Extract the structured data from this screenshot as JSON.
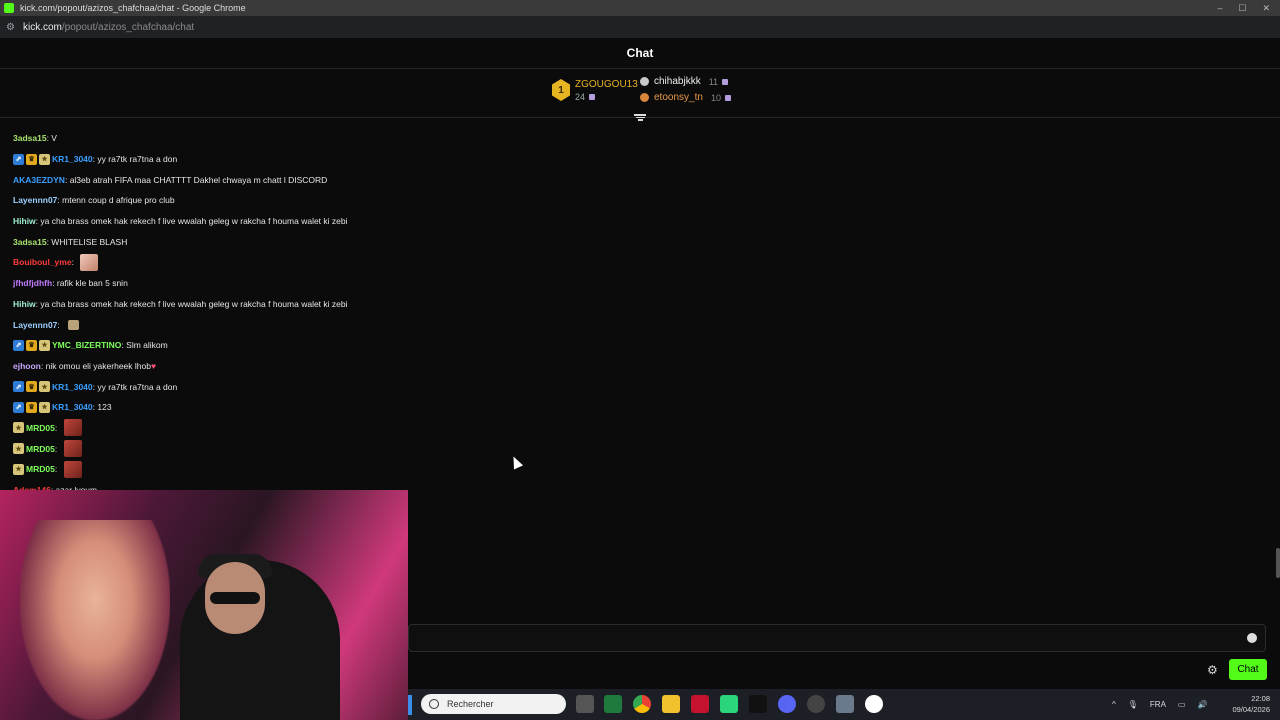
{
  "browser": {
    "window_title": "kick.com/popout/azizos_chafchaa/chat - Google Chrome",
    "url_host": "kick.com",
    "url_path": "/popout/azizos_chafchaa/chat"
  },
  "chat": {
    "title": "Chat",
    "leaderboard": {
      "first": {
        "rank": "1",
        "name": "ZGOUGOU13",
        "count": "24"
      },
      "second": {
        "name": "chihabjkkk",
        "count": "11"
      },
      "third": {
        "name": "etoonsy_tn",
        "count": "10"
      }
    },
    "messages": [
      {
        "user": "3adsa15",
        "color": "#a8e36b",
        "badges": [],
        "text": "V"
      },
      {
        "user": "KR1_3040",
        "color": "#3aa0ff",
        "badges": [
          "blue",
          "gold",
          "sub"
        ],
        "text": "yy ra7tk ra7tna a don"
      },
      {
        "user": "AKA3EZDYN",
        "color": "#3aa0ff",
        "badges": [],
        "text": "al3eb atrah FIFA maa CHATTTT Dakhel chwaya m chatt l DISCORD"
      },
      {
        "user": "Layennn07",
        "color": "#9ed0ff",
        "badges": [],
        "text": "mtenn coup d afrique pro club"
      },
      {
        "user": "Hihiw",
        "color": "#9ff0d0",
        "badges": [],
        "text": "ya cha brass omek hak rekech f live wwalah geleg w rakcha f houma walet ki zebi"
      },
      {
        "user": "3adsa15",
        "color": "#a8e36b",
        "badges": [],
        "text": "WHITELISE BLASH"
      },
      {
        "user": "Bouiboul_yme",
        "color": "#ff3b3b",
        "badges": [],
        "text": "",
        "emote": "face"
      },
      {
        "user": "jfhdfjdhfh",
        "color": "#c07bff",
        "badges": [],
        "text": "rafik kle ban 5 snin"
      },
      {
        "user": "Hihiw",
        "color": "#9ff0d0",
        "badges": [],
        "text": "ya cha brass omek hak rekech f live wwalah geleg w rakcha f houma walet ki zebi"
      },
      {
        "user": "Layennn07",
        "color": "#9ed0ff",
        "badges": [],
        "text": "",
        "emote": "small"
      },
      {
        "user": "YMC_BIZERTINO",
        "color": "#7dff5a",
        "badges": [
          "blue",
          "gold",
          "sub"
        ],
        "text": "Slm alikom"
      },
      {
        "user": "ejhoon",
        "color": "#c8a8ff",
        "badges": [],
        "text": "nik omou eli yakerheek lhob",
        "heart": "♥"
      },
      {
        "user": "KR1_3040",
        "color": "#3aa0ff",
        "badges": [
          "blue",
          "gold",
          "sub"
        ],
        "text": "yy ra7tk ra7tna a don"
      },
      {
        "user": "KR1_3040",
        "color": "#3aa0ff",
        "badges": [
          "blue",
          "gold",
          "sub"
        ],
        "text": "123"
      },
      {
        "user": "MRD05",
        "color": "#7dff5a",
        "badges": [
          "sub"
        ],
        "text": "",
        "emote": "red"
      },
      {
        "user": "MRD05",
        "color": "#7dff5a",
        "badges": [
          "sub"
        ],
        "text": "",
        "emote": "red"
      },
      {
        "user": "MRD05",
        "color": "#7dff5a",
        "badges": [
          "sub"
        ],
        "text": "",
        "emote": "red"
      },
      {
        "user": "Adem146",
        "color": "#ff3b3b",
        "badges": [],
        "text": "azar lvoum"
      }
    ],
    "send_label": "Chat"
  },
  "taskbar": {
    "search_placeholder": "Rechercher",
    "language": "FRA",
    "time": "22:08",
    "date": "09/04/2026"
  },
  "colors": {
    "accent": "#53fc18",
    "gold": "#e7b422"
  },
  "icons": [
    "settings-icon",
    "emoji-icon",
    "filter-icon",
    "search-icon",
    "mic-icon",
    "speaker-icon"
  ]
}
